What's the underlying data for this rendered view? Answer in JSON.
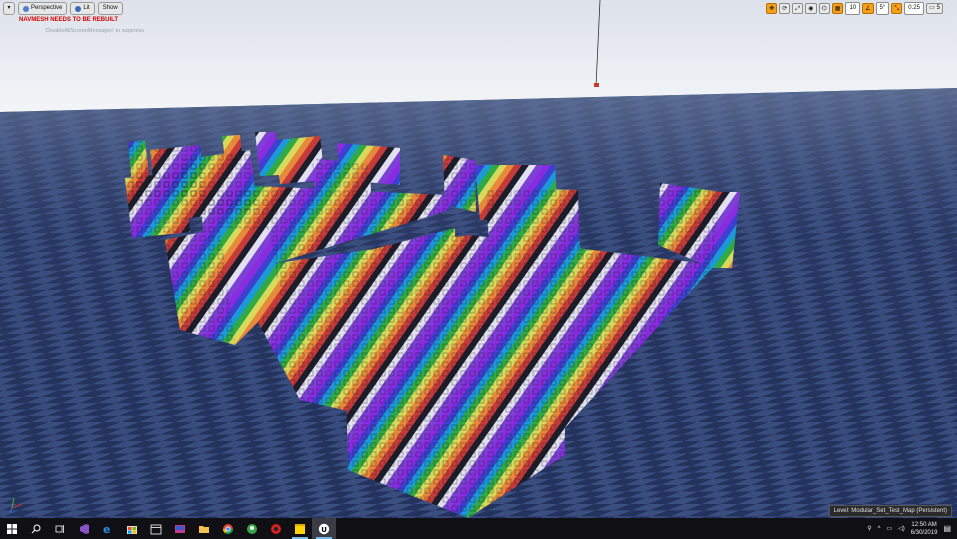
{
  "viewport": {
    "menu_glyph": "▾",
    "perspective_label": "Perspective",
    "lit_label": "Lit",
    "show_label": "Show",
    "warning": "NAVMESH NEEDS TO BE REBUILT",
    "suppress_hint": "'DisableAllScreenMessages' to suppress",
    "level_label": "Level:  Modular_Set_Test_Map (Persistent)"
  },
  "toolbar_right": {
    "grid_snap": "10",
    "rotation_snap": "5°",
    "scale_snap": "0.25",
    "camera_speed": "5"
  },
  "taskbar": {
    "time": "12:50 AM",
    "date": "6/30/2019"
  },
  "colors": {
    "sky": "#e7ebf1",
    "floor_dark": "#23315a",
    "floor_light": "#3c5080",
    "accent_orange": "#f6a01a",
    "warning_red": "#d40000"
  }
}
